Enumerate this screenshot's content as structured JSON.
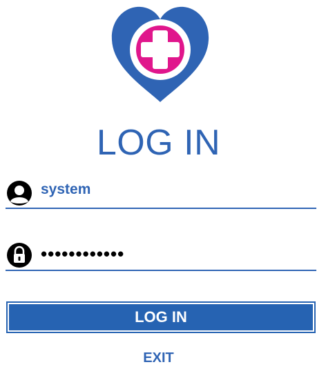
{
  "header": {
    "logo_icon": "heart-medical-cross-icon",
    "title": "LOG IN"
  },
  "form": {
    "username": {
      "icon": "user-icon",
      "value": "system"
    },
    "password": {
      "icon": "lock-icon",
      "masked_value": "••••••••••••"
    },
    "login_label": "LOG IN",
    "exit_label": "EXIT"
  },
  "colors": {
    "brand_blue": "#2f64b4",
    "button_blue": "#2663b2",
    "cross_pink": "#e0168c"
  }
}
